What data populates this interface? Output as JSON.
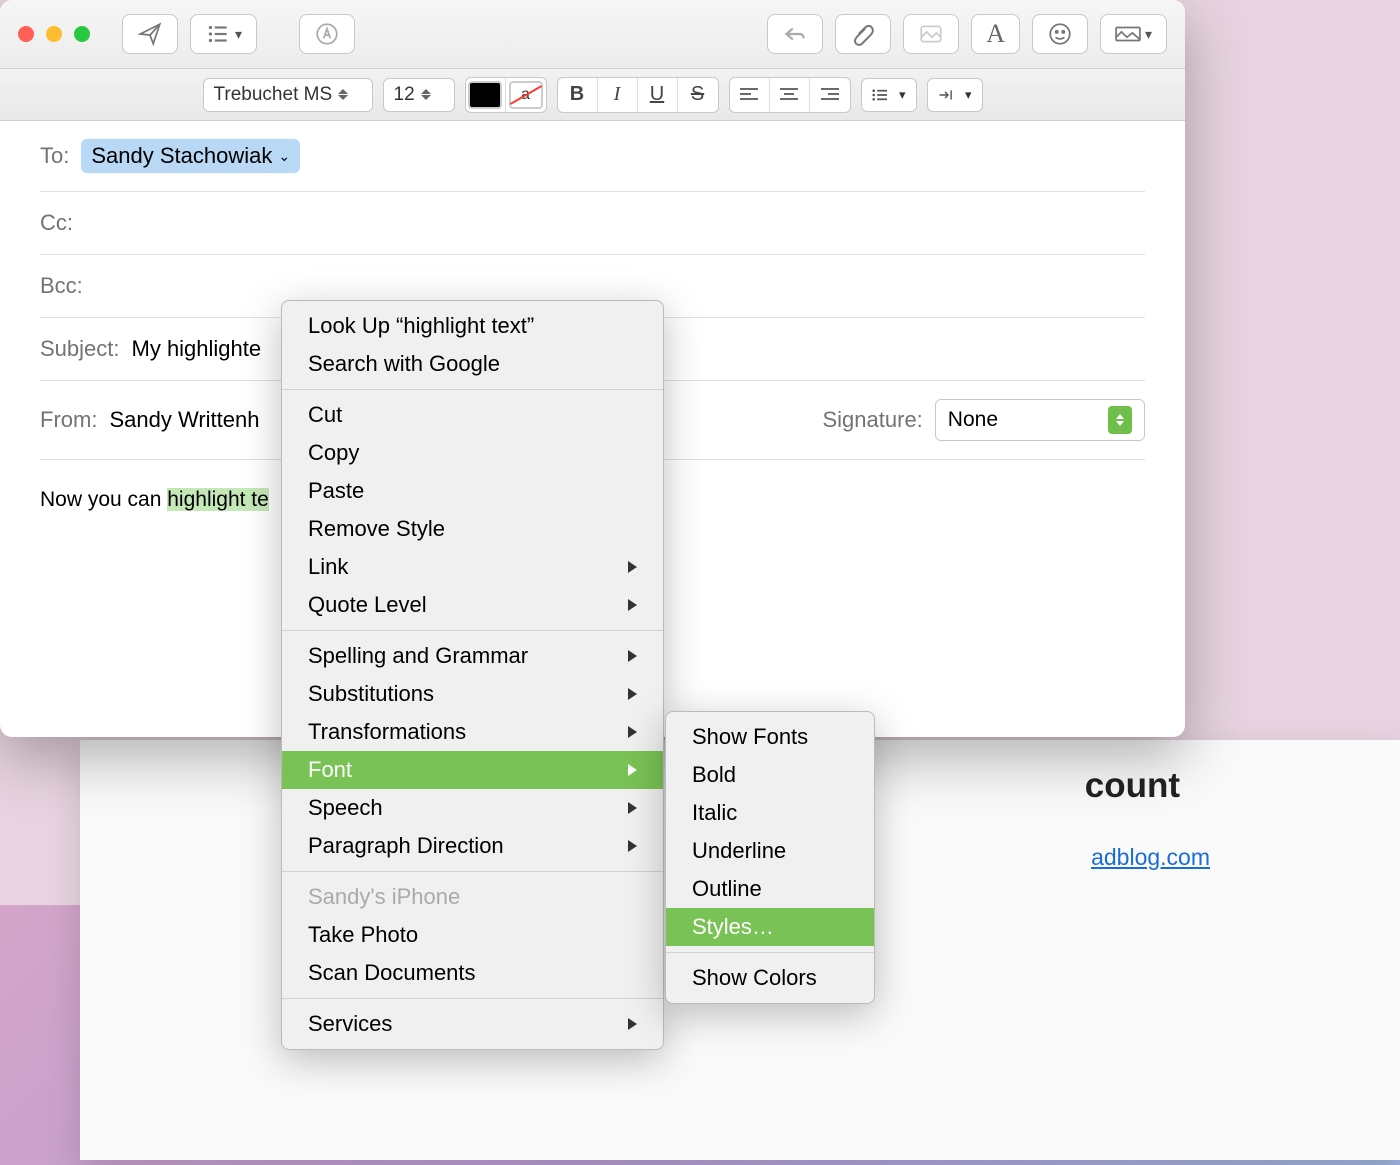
{
  "toolbar": {},
  "formatbar": {
    "font": "Trebuchet MS",
    "size": "12"
  },
  "fields": {
    "to_label": "To:",
    "to_token": "Sandy Stachowiak",
    "cc_label": "Cc:",
    "bcc_label": "Bcc:",
    "subject_label": "Subject:",
    "subject_value": "My highlighte",
    "from_label": "From:",
    "from_value": "Sandy Writtenh",
    "signature_label": "Signature:",
    "signature_value": "None"
  },
  "body": {
    "before": "Now you can ",
    "highlighted": "highlight te"
  },
  "context_menu": {
    "lookup": "Look Up “highlight text”",
    "search": "Search with Google",
    "cut": "Cut",
    "copy": "Copy",
    "paste": "Paste",
    "remove_style": "Remove Style",
    "link": "Link",
    "quote_level": "Quote Level",
    "spelling": "Spelling and Grammar",
    "substitutions": "Substitutions",
    "transformations": "Transformations",
    "font": "Font",
    "speech": "Speech",
    "paragraph_direction": "Paragraph Direction",
    "device": "Sandy's iPhone",
    "take_photo": "Take Photo",
    "scan_documents": "Scan Documents",
    "services": "Services"
  },
  "font_submenu": {
    "show_fonts": "Show Fonts",
    "bold": "Bold",
    "italic": "Italic",
    "underline": "Underline",
    "outline": "Outline",
    "styles": "Styles…",
    "show_colors": "Show Colors"
  },
  "background": {
    "title_fragment": "count",
    "link_fragment": "adblog.com"
  }
}
